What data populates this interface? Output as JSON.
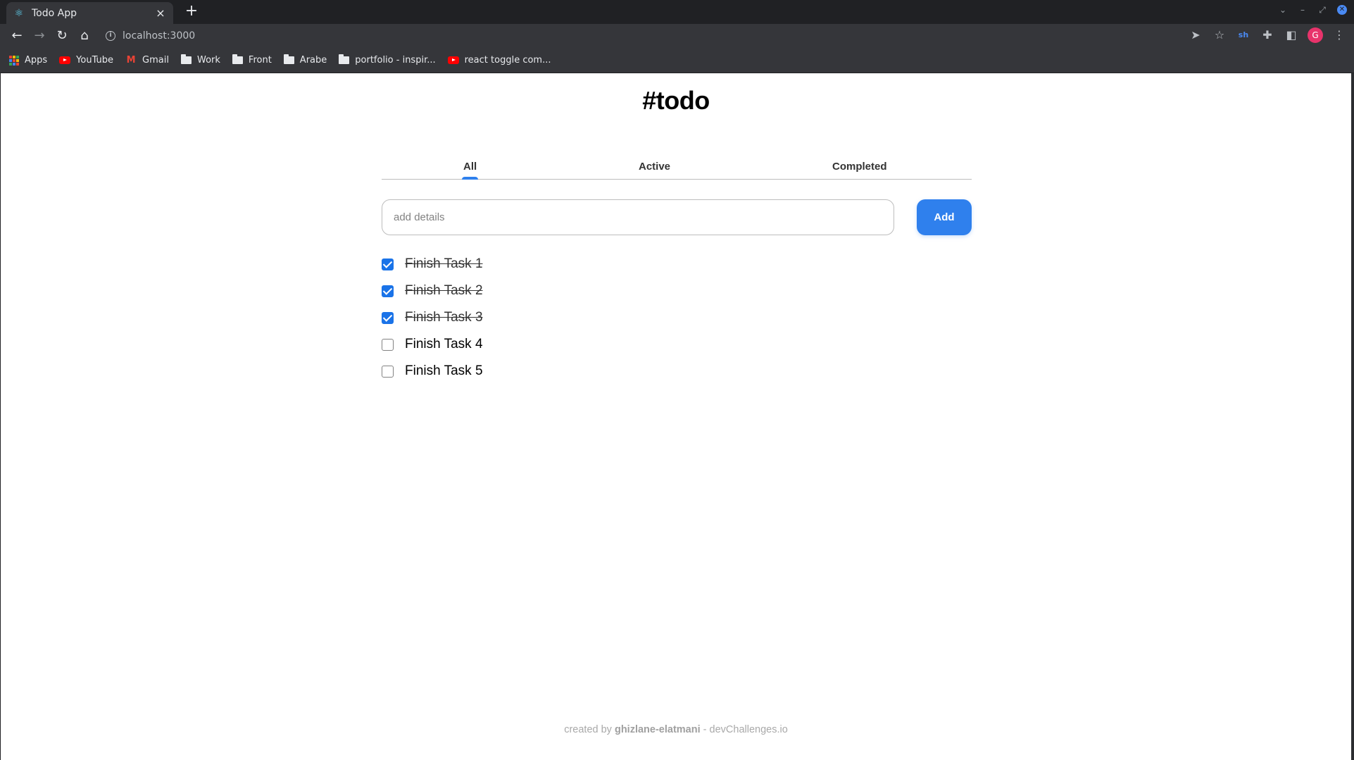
{
  "browser": {
    "tab_title": "Todo App",
    "tab_close": "×",
    "new_tab": "+",
    "url": "localhost:3000",
    "avatar_letter": "G",
    "extension_label": "sh",
    "bookmarks": [
      {
        "label": "Apps",
        "icon": "apps-grid-icon"
      },
      {
        "label": "YouTube",
        "icon": "youtube-icon"
      },
      {
        "label": "Gmail",
        "icon": "gmail-icon"
      },
      {
        "label": "Work",
        "icon": "folder-icon"
      },
      {
        "label": "Front",
        "icon": "folder-icon"
      },
      {
        "label": "Arabe",
        "icon": "folder-icon"
      },
      {
        "label": "portfolio - inspir...",
        "icon": "folder-icon"
      },
      {
        "label": "react toggle com...",
        "icon": "youtube-icon"
      }
    ]
  },
  "app": {
    "title": "#todo",
    "tabs": [
      {
        "label": "All",
        "active": true
      },
      {
        "label": "Active",
        "active": false
      },
      {
        "label": "Completed",
        "active": false
      }
    ],
    "input_placeholder": "add details",
    "input_value": "",
    "add_label": "Add",
    "todos": [
      {
        "text": "Finish Task 1",
        "done": true
      },
      {
        "text": "Finish Task 2",
        "done": true
      },
      {
        "text": "Finish Task 3",
        "done": true
      },
      {
        "text": "Finish Task 4",
        "done": false
      },
      {
        "text": "Finish Task 5",
        "done": false
      }
    ],
    "footer": {
      "prefix": "created by ",
      "author": "ghizlane-elatmani",
      "suffix": " - devChallenges.io"
    }
  },
  "colors": {
    "accent": "#2f80ed",
    "checkbox_checked": "#1a73e8"
  }
}
